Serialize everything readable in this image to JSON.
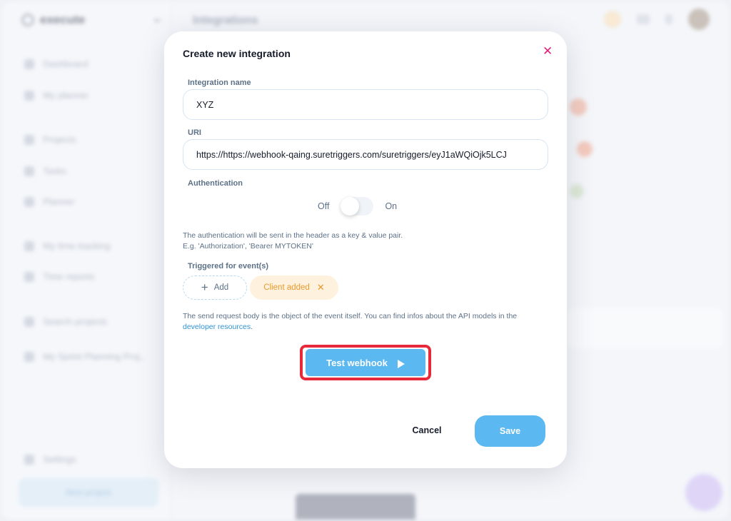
{
  "background": {
    "app_name": "execute",
    "page_title": "Integrations",
    "sidebar_items": [
      "Dashboard",
      "My planner",
      "Projects",
      "Tasks",
      "Planner",
      "My time tracking",
      "Time reports",
      "Search projects",
      "My Sprint Planning Proj..",
      "Settings"
    ],
    "sidebar_button": "New project"
  },
  "modal": {
    "title": "Create new integration",
    "close_icon": "close-icon",
    "integration_name": {
      "label": "Integration name",
      "value": "XYZ"
    },
    "uri": {
      "label": "URI",
      "value": "https://https://webhook-qaing.suretriggers.com/suretriggers/eyJ1aWQiOjk5LCJ"
    },
    "authentication": {
      "label": "Authentication",
      "off_label": "Off",
      "on_label": "On",
      "enabled": false
    },
    "auth_hint_line1": "The authentication will be sent in the header as a key & value pair.",
    "auth_hint_line2": "E.g. 'Authorization', 'Bearer MYTOKEN'",
    "events": {
      "label": "Triggered for event(s)",
      "add_label": "Add",
      "chips": [
        "Client added"
      ]
    },
    "body_hint": "The send request body is the object of the event itself. You can find infos about the API models in the",
    "body_hint_link": "developer resources",
    "body_hint_end": ".",
    "test_button": "Test webhook",
    "cancel_button": "Cancel",
    "save_button": "Save"
  },
  "colors": {
    "accent": "#5bb8f0",
    "close": "#e2217a",
    "chip_bg": "#fef1dd",
    "chip_text": "#e79b2e",
    "highlight": "#e62a3c"
  }
}
